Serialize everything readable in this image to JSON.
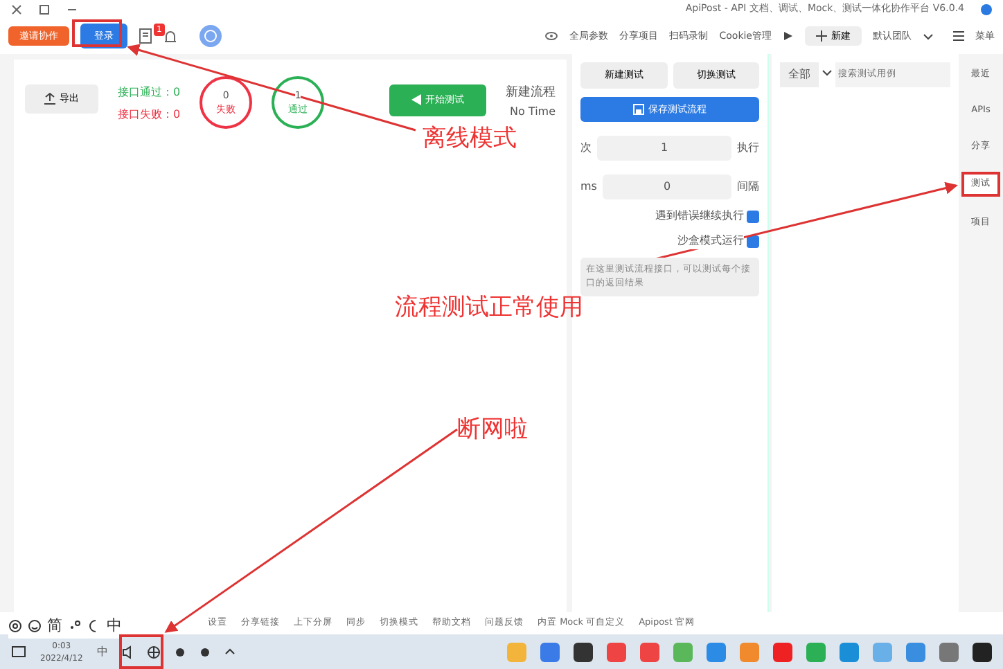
{
  "window": {
    "title": "ApiPost - API 文档、调试、Mock、测试一体化协作平台 V6.0.4"
  },
  "toolbar": {
    "actions": [
      {
        "label": "邀请协作",
        "kind": "invite"
      },
      {
        "label": "登录",
        "kind": "login"
      }
    ],
    "notification_badge": "1",
    "items": [
      {
        "label": "全局参数"
      },
      {
        "label": "分享项目"
      },
      {
        "label": "扫码录制"
      },
      {
        "label": "Cookie管理"
      }
    ],
    "new_label": "新建",
    "team": "默认团队",
    "menu": "菜单"
  },
  "main": {
    "title": "新建流程",
    "subtitle": "No Time",
    "start_button": "开始测试",
    "counters": [
      {
        "value": "0",
        "label": "失败",
        "kind": "fail"
      },
      {
        "value": "1",
        "label": "通过",
        "kind": "pass"
      }
    ],
    "stats": [
      {
        "text": "接口通过：0",
        "kind": "pass"
      },
      {
        "text": "接口失败：0",
        "kind": "fail"
      }
    ],
    "export_button": "导出"
  },
  "config": {
    "buttons": [
      "新建测试",
      "切换测试"
    ],
    "save_button": "保存测试流程",
    "fields": [
      {
        "label": "执行",
        "value": "1",
        "unit": "次"
      },
      {
        "label": "间隔",
        "value": "0",
        "unit": "ms"
      }
    ],
    "options": [
      {
        "label": "遇到错误继续执行",
        "checked": true
      },
      {
        "label": "沙盒模式运行",
        "checked": true
      }
    ],
    "note": "在这里测试流程接口，可以测试每个接口的返回结果"
  },
  "list": {
    "search": {
      "placeholder": "搜索测试用例"
    },
    "filter": "全部"
  },
  "nav": [
    {
      "label": "最近",
      "selected": false
    },
    {
      "label": "APIs",
      "selected": false
    },
    {
      "label": "分享",
      "selected": false
    },
    {
      "label": "测试",
      "selected": true
    },
    {
      "label": "项目",
      "selected": false
    }
  ],
  "status_bar": [
    "设置",
    "分享链接",
    "上下分屏",
    "同步",
    "切换模式",
    "帮助文档",
    "问题反馈",
    "内置 Mock 可自定义",
    "Apipost 官网"
  ],
  "ime_bar": [
    "简",
    "中"
  ],
  "taskbar": {
    "time": "0:03",
    "date": "2022/4/12",
    "ime": "中"
  },
  "annotations": [
    {
      "text": "离线模式"
    },
    {
      "text": "流程测试正常使用"
    },
    {
      "text": "断网啦"
    }
  ]
}
